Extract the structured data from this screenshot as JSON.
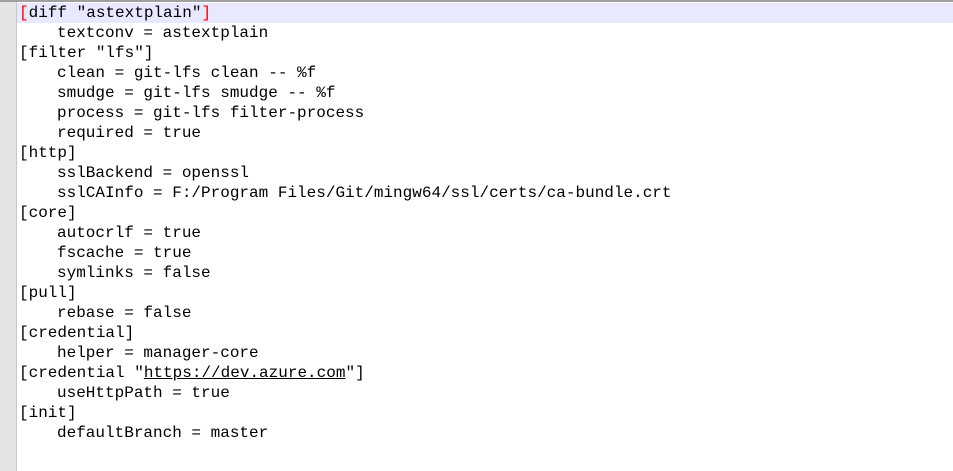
{
  "lines": [
    {
      "pre": "",
      "bracket_open": "[",
      "text": "diff \"astextplain\"",
      "bracket_close": "]"
    },
    {
      "indent": true,
      "text": "textconv = astextplain"
    },
    {
      "text": "[filter \"lfs\"]"
    },
    {
      "indent": true,
      "text": "clean = git-lfs clean -- %f"
    },
    {
      "indent": true,
      "text": "smudge = git-lfs smudge -- %f"
    },
    {
      "indent": true,
      "text": "process = git-lfs filter-process"
    },
    {
      "indent": true,
      "text": "required = true"
    },
    {
      "text": "[http]"
    },
    {
      "indent": true,
      "text": "sslBackend = openssl"
    },
    {
      "indent": true,
      "text": "sslCAInfo = F:/Program Files/Git/mingw64/ssl/certs/ca-bundle.crt"
    },
    {
      "text": "[core]"
    },
    {
      "indent": true,
      "text": "autocrlf = true"
    },
    {
      "indent": true,
      "text": "fscache = true"
    },
    {
      "indent": true,
      "text": "symlinks = false"
    },
    {
      "text": "[pull]"
    },
    {
      "indent": true,
      "text": "rebase = false"
    },
    {
      "text": "[credential]"
    },
    {
      "indent": true,
      "text": "helper = manager-core"
    },
    {
      "link_pre": "[credential \"",
      "link": "https://dev.azure.com",
      "link_post": "\"]"
    },
    {
      "indent": true,
      "text": "useHttpPath = true"
    },
    {
      "text": "[init]"
    },
    {
      "indent": true,
      "text": "defaultBranch = master"
    }
  ],
  "colors": {
    "current_line": "#e8e8ff",
    "bracket_highlight": "#ff0000",
    "gutter": "#e4e4e4"
  }
}
